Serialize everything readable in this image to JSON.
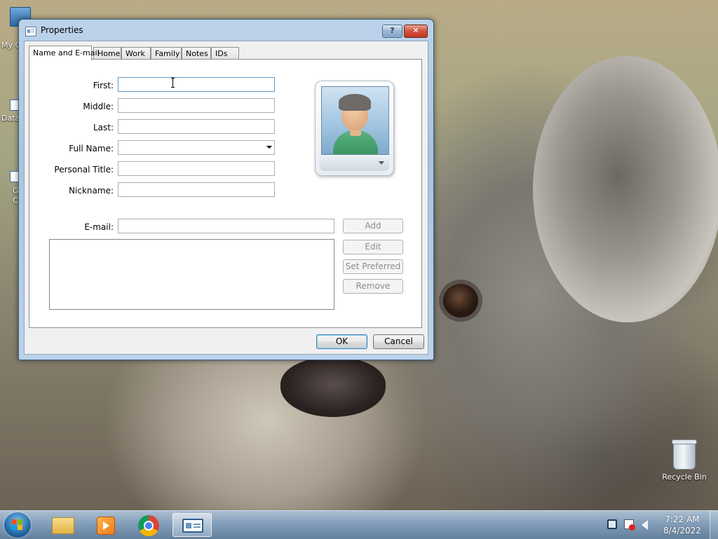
{
  "desktop": {
    "icons": [
      {
        "label": "My C",
        "icon": "computer-icon"
      },
      {
        "label": "Data",
        "icon": "shortcut-icon"
      },
      {
        "label": "G\nC",
        "icon": "shortcut-icon"
      }
    ],
    "recycle_bin": {
      "label": "Recycle Bin",
      "icon": "recycle-bin-icon"
    }
  },
  "window": {
    "title": "Properties",
    "help_button": "?",
    "close_button": "✕",
    "tabs": [
      {
        "label": "Name and E-mail",
        "active": true
      },
      {
        "label": "Home"
      },
      {
        "label": "Work"
      },
      {
        "label": "Family"
      },
      {
        "label": "Notes"
      },
      {
        "label": "IDs"
      }
    ],
    "form": {
      "first": {
        "label": "First:",
        "value": ""
      },
      "middle": {
        "label": "Middle:",
        "value": ""
      },
      "last": {
        "label": "Last:",
        "value": ""
      },
      "full_name": {
        "label": "Full Name:",
        "value": ""
      },
      "personal_title": {
        "label": "Personal Title:",
        "value": ""
      },
      "nickname": {
        "label": "Nickname:",
        "value": ""
      },
      "email": {
        "label": "E-mail:",
        "value": ""
      }
    },
    "email_buttons": {
      "add": "Add",
      "edit": "Edit",
      "set_preferred": "Set Preferred",
      "remove": "Remove"
    },
    "footer": {
      "ok": "OK",
      "cancel": "Cancel"
    }
  },
  "taskbar": {
    "items": [
      {
        "name": "start-button",
        "icon": "windows-logo-icon"
      },
      {
        "name": "explorer",
        "icon": "folder-icon"
      },
      {
        "name": "media-player",
        "icon": "media-player-icon"
      },
      {
        "name": "chrome",
        "icon": "chrome-icon"
      },
      {
        "name": "contacts",
        "icon": "contact-card-icon",
        "active": true
      }
    ],
    "tray_icons": [
      "network-icon",
      "action-center-icon",
      "volume-icon"
    ],
    "time": "7:22 AM",
    "date": "8/4/2022"
  },
  "colors": {
    "window_frame": "#a9c4e0",
    "close_button": "#c23a22",
    "taskbar": "#7896b4",
    "focus_border": "#5c97c9"
  }
}
